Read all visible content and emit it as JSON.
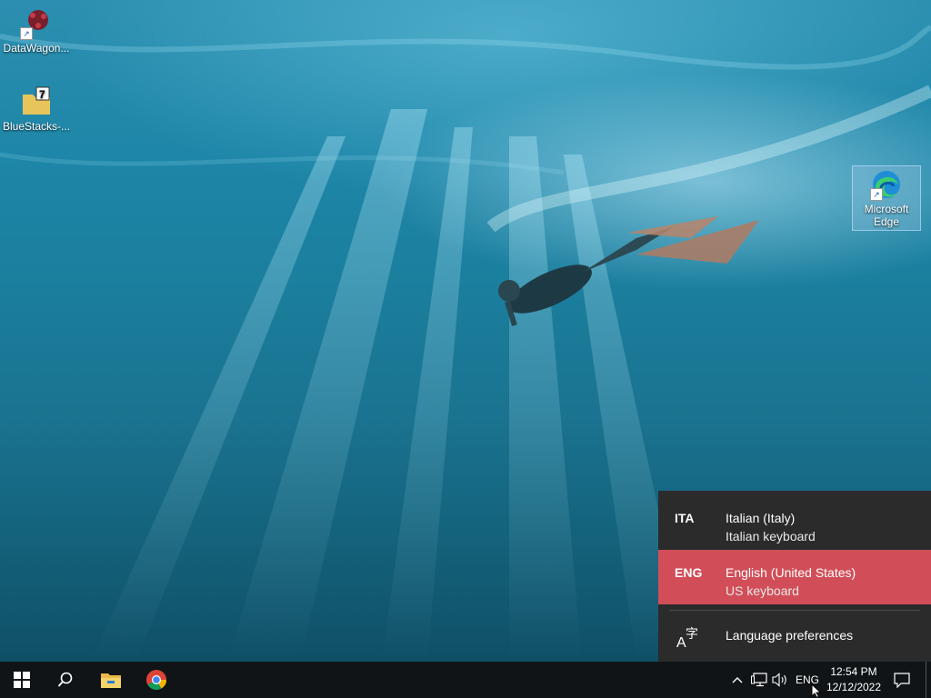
{
  "desktop": {
    "icons": [
      {
        "label": "DataWagon...",
        "icon": "datawagon-icon"
      },
      {
        "label": "BlueStacks-...",
        "icon": "archive-7z-icon"
      },
      {
        "label": "Microsoft Edge",
        "icon": "edge-icon"
      }
    ]
  },
  "language_flyout": {
    "items": [
      {
        "code": "ITA",
        "name": "Italian (Italy)",
        "keyboard": "Italian keyboard",
        "selected": false
      },
      {
        "code": "ENG",
        "name": "English (United States)",
        "keyboard": "US keyboard",
        "selected": true
      }
    ],
    "preferences_label": "Language preferences",
    "selected_color": "#d14e58"
  },
  "taskbar": {
    "start_icon": "windows-logo-icon",
    "search_icon": "search-icon",
    "pinned": [
      "file-explorer-icon",
      "chrome-icon"
    ],
    "tray": {
      "language": "ENG",
      "time": "12:54 PM",
      "date": "12/12/2022"
    }
  }
}
